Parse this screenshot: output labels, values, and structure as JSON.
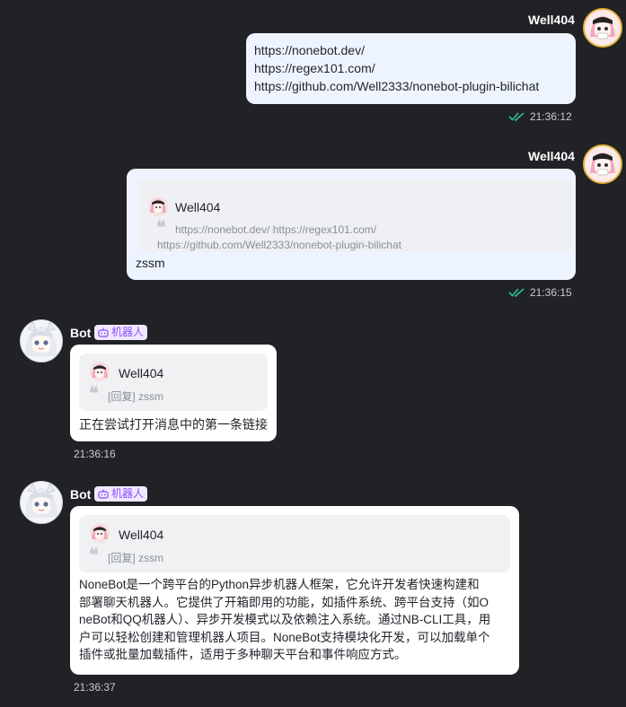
{
  "colors": {
    "background": "#202226",
    "outgoing_bubble": "#eef4ff",
    "incoming_bubble": "#ffffff",
    "read_check": "#2fbf8f",
    "bot_tag_text": "#8a4dff"
  },
  "messages": [
    {
      "sender": "Well404",
      "lines": [
        "https://nonebot.dev/",
        "https://regex101.com/",
        "https://github.com/Well2333/nonebot-plugin-bilichat"
      ],
      "time": "21:36:12",
      "status_icon": "double-check-icon"
    },
    {
      "sender": "Well404",
      "reply": {
        "name": "Well404",
        "line1": "https://nonebot.dev/ https://regex101.com/",
        "line2": "https://github.com/Well2333/nonebot-plugin-bilichat"
      },
      "text": "zssm",
      "time": "21:36:15",
      "status_icon": "double-check-icon"
    },
    {
      "sender": "Bot",
      "tag": "机器人",
      "reply": {
        "name": "Well404",
        "text": "[回复] zssm"
      },
      "text": "正在尝试打开消息中的第一条链接",
      "time": "21:36:16"
    },
    {
      "sender": "Bot",
      "tag": "机器人",
      "reply": {
        "name": "Well404",
        "text": "[回复] zssm"
      },
      "lines": [
        "NoneBot是一个跨平台的Python异步机器人框架，它允许开发者快速构建和",
        "部署聊天机器人。它提供了开箱即用的功能，如插件系统、跨平台支持（如O",
        "neBot和QQ机器人）、异步开发模式以及依赖注入系统。通过NB-CLI工具，用",
        "户可以轻松创建和管理机器人项目。NoneBot支持模块化开发，可以加载单个",
        "插件或批量加载插件，适用于多种聊天平台和事件响应方式。"
      ],
      "time": "21:36:37"
    }
  ]
}
